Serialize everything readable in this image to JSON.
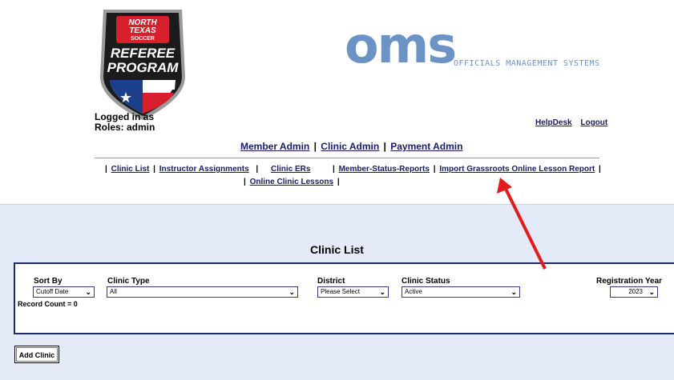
{
  "logo_referee": {
    "top_text": [
      "NORTH",
      "TEXAS",
      "SOCCER"
    ],
    "main_text": [
      "REFEREE",
      "PROGRAM"
    ]
  },
  "logo_oms": {
    "big": "oms",
    "sub": "OFFICIALS MANAGEMENT SYSTEMS"
  },
  "user": {
    "logged_in": "Logged in as",
    "roles": "Roles: admin"
  },
  "toplinks": {
    "helpdesk": "HelpDesk",
    "logout": "Logout"
  },
  "mainnav": {
    "member_admin": "Member Admin",
    "clinic_admin": "Clinic Admin",
    "payment_admin": "Payment Admin",
    "sep": "|"
  },
  "subnav": {
    "clinic_list": "Clinic List",
    "instructor_assignments": "Instructor Assignments",
    "clinic_ers": "Clinic ERs",
    "member_status_reports": "Member-Status-Reports",
    "import_grassroots": "Import Grassroots Online Lesson Report",
    "online_clinic_lessons": "Online Clinic Lessons",
    "sep": "|"
  },
  "panel": {
    "title": "Clinic List"
  },
  "filters": {
    "sort_by": {
      "label": "Sort By",
      "value": "Cutoff Date"
    },
    "clinic_type": {
      "label": "Clinic Type",
      "value": "All"
    },
    "district": {
      "label": "District",
      "value": "Please Select"
    },
    "clinic_status": {
      "label": "Clinic Status",
      "value": "Active"
    },
    "registration_year": {
      "label": "Registration Year",
      "value": "2023"
    }
  },
  "record_count": "Record Count = 0",
  "add_clinic": "Add Clinic",
  "colors": {
    "oms_blue": "#6c93c6",
    "panel_bg": "#e4eaf7",
    "box_border": "#1f2a6a",
    "arrow": "#e41b1b",
    "shield_dark": "#1b1b1b"
  }
}
